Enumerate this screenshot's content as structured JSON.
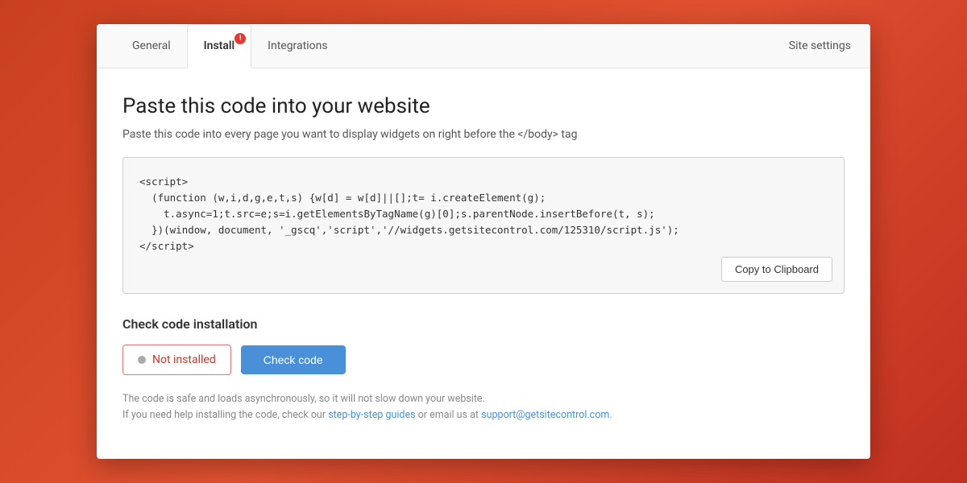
{
  "background": {
    "color": "#d94f2a"
  },
  "modal": {
    "tabs": [
      {
        "id": "general",
        "label": "General",
        "active": false,
        "badge": false
      },
      {
        "id": "install",
        "label": "Install",
        "active": true,
        "badge": true
      },
      {
        "id": "integrations",
        "label": "Integrations",
        "active": false,
        "badge": false
      }
    ],
    "site_settings_label": "Site settings",
    "page_title": "Paste this code into your website",
    "page_subtitle": "Paste this code into every page you want to display widgets on right before the </body> tag",
    "code_snippet": "<script>\n  (function (w,i,d,g,e,t,s) {w[d] = w[d]||[];t= i.createElement(g);\n    t.async=1;t.src=e;s=i.getElementsByTagName(g)[0];s.parentNode.insertBefore(t, s);\n  })(window, document, '_gscq','script','//widgets.getsitecontrol.com/125310/script.js');\n</script>",
    "copy_button_label": "Copy to Clipboard",
    "check_section_title": "Check code installation",
    "not_installed_label": "Not installed",
    "check_code_button_label": "Check code",
    "footer_line1": "The code is safe and loads asynchronously, so it will not slow down your website.",
    "footer_line2_prefix": "If you need help installing the code, check our ",
    "footer_link1_label": "step-by-step guides",
    "footer_link1_href": "#",
    "footer_middle": " or email us at ",
    "footer_link2_label": "support@getsitecontrol.com",
    "footer_link2_href": "#",
    "footer_end": "."
  }
}
